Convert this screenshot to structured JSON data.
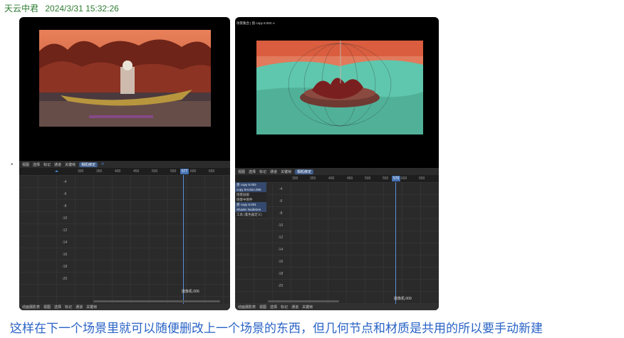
{
  "header": {
    "author": "天云中君",
    "timestamp": "2024/3/31 15:32:26"
  },
  "left_shot": {
    "toolbar": [
      "视图",
      "选择",
      "标记",
      "通道",
      "关键帧"
    ],
    "toolbar_active": "相机绑定",
    "ruler_ticks": [
      "300",
      "350",
      "400",
      "450",
      "500",
      "550",
      "577",
      "600",
      "650"
    ],
    "current_frame": "577",
    "y_labels": [
      "-4",
      "-6",
      "-8",
      "-10",
      "-12",
      "-14",
      "-16",
      "-18",
      "-20"
    ],
    "camera_label": "摄像机.006",
    "bottombar": [
      "动画摄影表",
      "视图",
      "选择",
      "标记",
      "通道",
      "关键帧"
    ]
  },
  "right_shot": {
    "top_title": "场景集合 | 盘 copy 6.002 ∞",
    "toolbar": [
      "视图",
      "选择",
      "标记",
      "通道",
      "关键帧"
    ],
    "toolbar_active": "相机绑定",
    "ruler_ticks": [
      "300",
      "350",
      "400",
      "450",
      "500",
      "550",
      "576",
      "600",
      "650"
    ],
    "current_frame": "576",
    "y_labels": [
      "-4",
      "-6",
      "-8",
      "-10",
      "-12",
      "-14",
      "-16",
      "-18",
      "-20"
    ],
    "side_items": [
      "盘 copy 6.002",
      "copy 8Action.065",
      "场景层级",
      "场景中原件",
      "盘 copy 6.001",
      "Shader Nodetree",
      "工具 (着色器定义)"
    ],
    "camera_label": "摄像机.009",
    "bottombar": [
      "动画摄影表",
      "视图",
      "选择",
      "标记",
      "通道",
      "关键帧"
    ]
  },
  "caption": "这样在下一个场景里就可以随便删改上一个场景的东西，但几何节点和材质是共用的所以要手动新建",
  "colors": {
    "caption": "#2a63c6",
    "header": "#2e7d32",
    "playhead": "#5b8fd8"
  }
}
